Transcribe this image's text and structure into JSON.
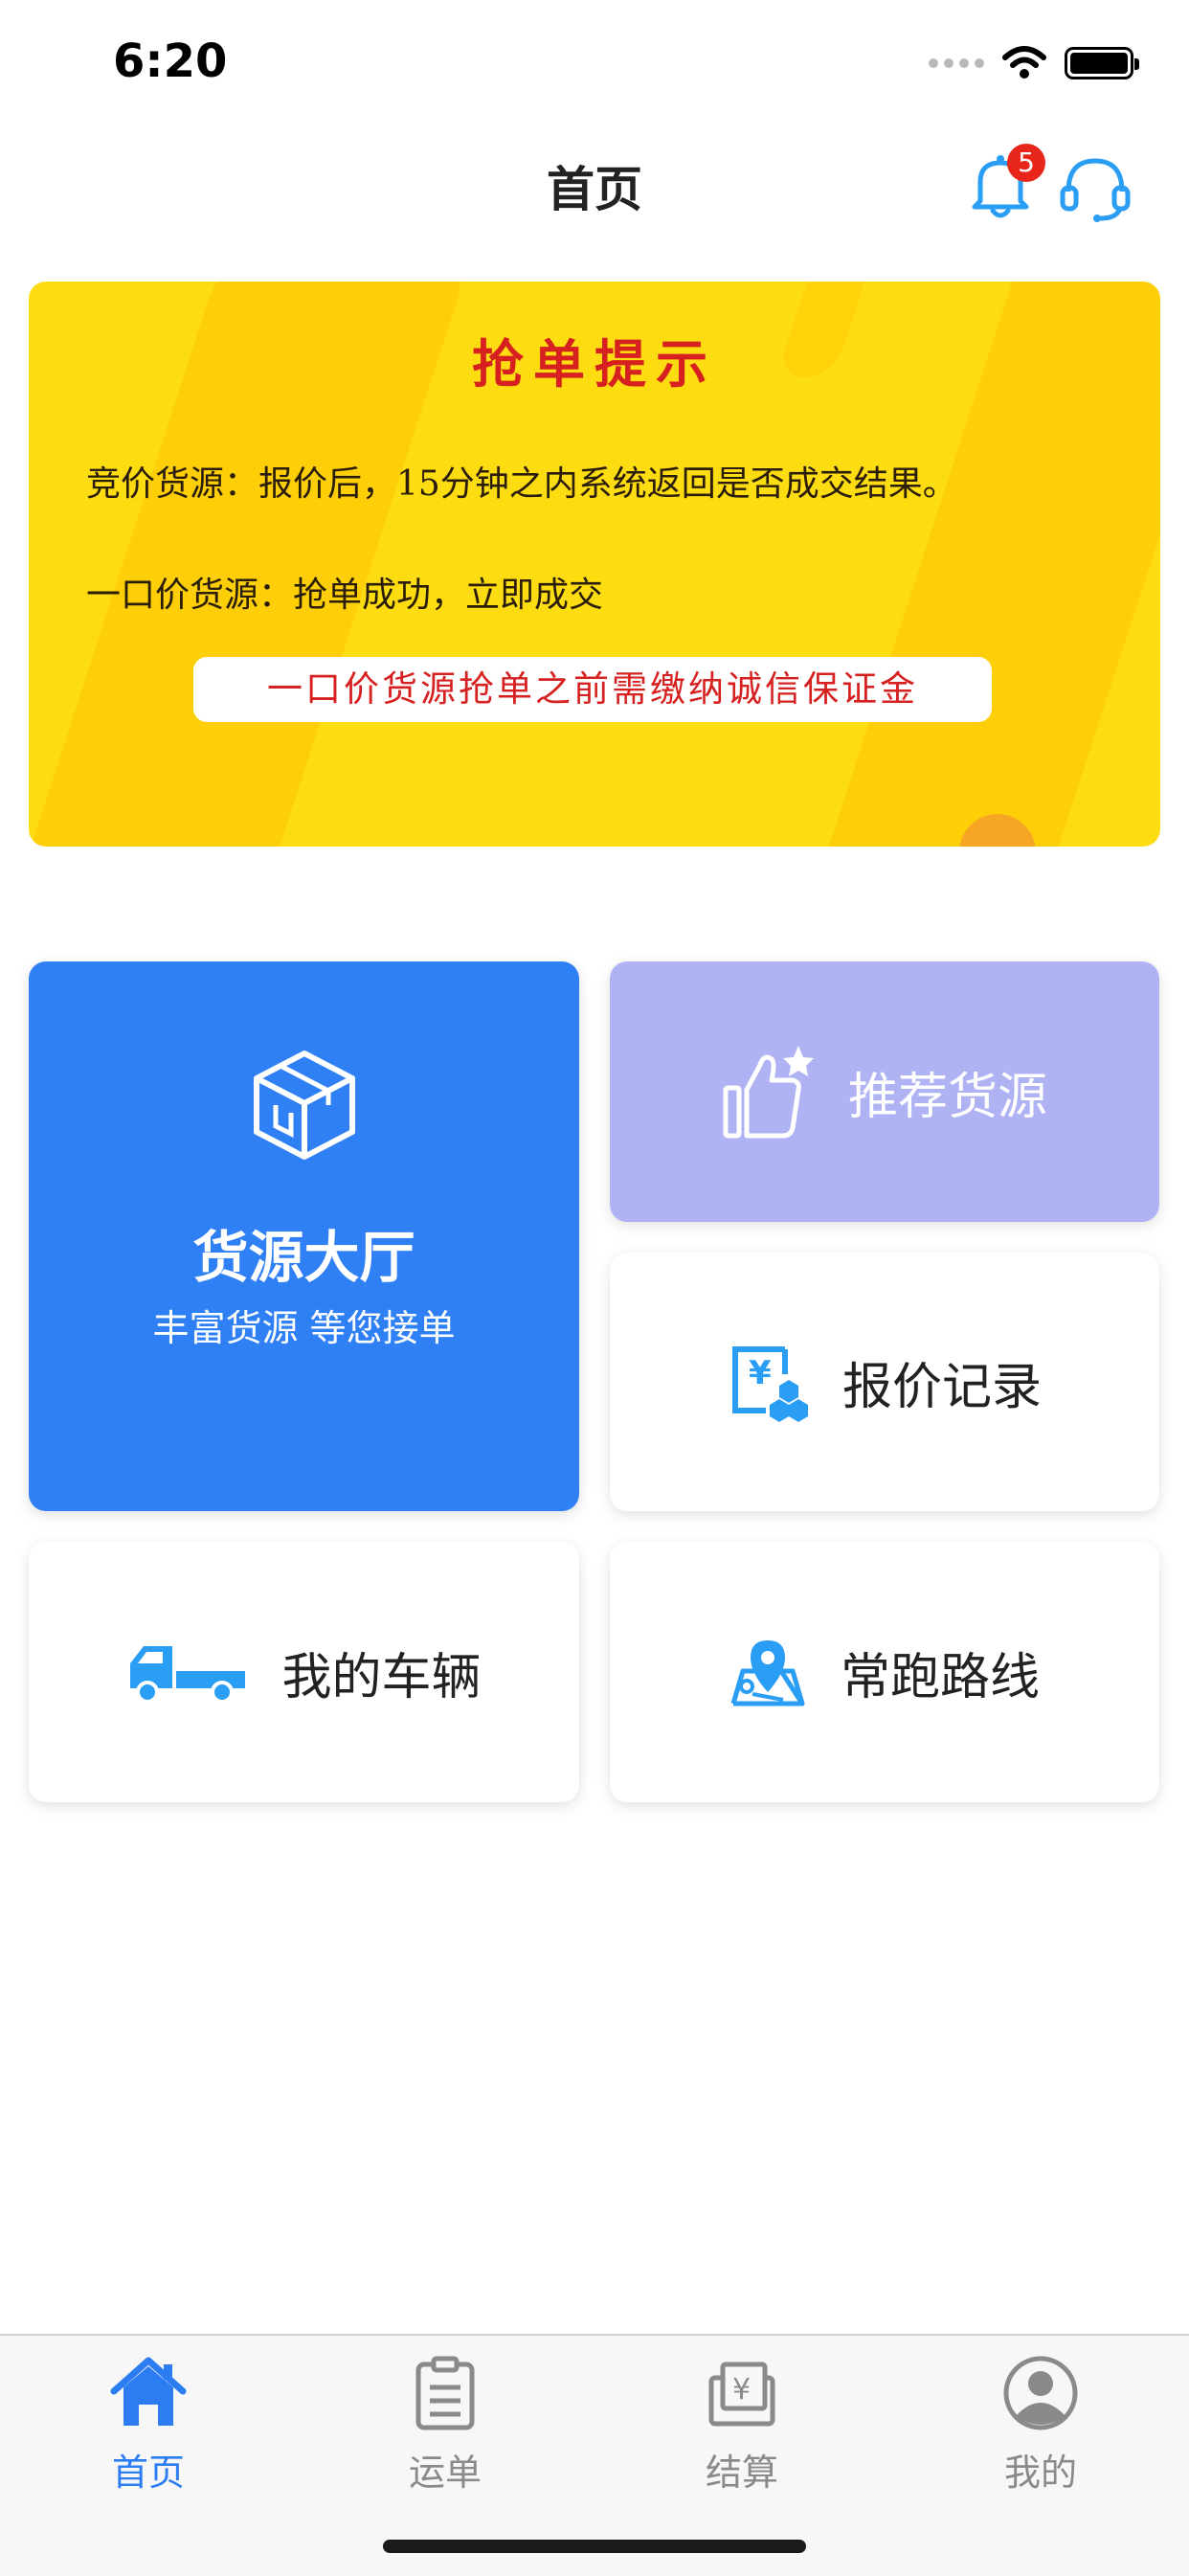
{
  "status_bar": {
    "time": "6:20"
  },
  "header": {
    "title": "首页",
    "notification_count": "5"
  },
  "banner": {
    "title": "抢单提示",
    "line1": "竞价货源：报价后，15分钟之内系统返回是否成交结果。",
    "line2": "一口价货源：抢单成功，立即成交",
    "notice": "一口价货源抢单之前需缴纳诚信保证金"
  },
  "cards": {
    "cargo_hall": {
      "title": "货源大厅",
      "subtitle": "丰富货源 等您接单"
    },
    "recommended": {
      "label": "推荐货源"
    },
    "quotes": {
      "label": "报价记录"
    },
    "vehicles": {
      "label": "我的车辆"
    },
    "routes": {
      "label": "常跑路线"
    }
  },
  "tabbar": {
    "items": [
      {
        "label": "首页",
        "icon": "home-icon",
        "active": true
      },
      {
        "label": "运单",
        "icon": "clipboard-icon",
        "active": false
      },
      {
        "label": "结算",
        "icon": "settlement-icon",
        "active": false
      },
      {
        "label": "我的",
        "icon": "profile-icon",
        "active": false
      }
    ]
  },
  "colors": {
    "accent": "#2f7ff5",
    "recommended_card": "#b0b3f3",
    "banner": "#fedc12",
    "badge": "#e8261c",
    "icon_blue": "#2a9df4",
    "tab_active": "#2c7df2",
    "tab_inactive": "#8a8a8a"
  }
}
